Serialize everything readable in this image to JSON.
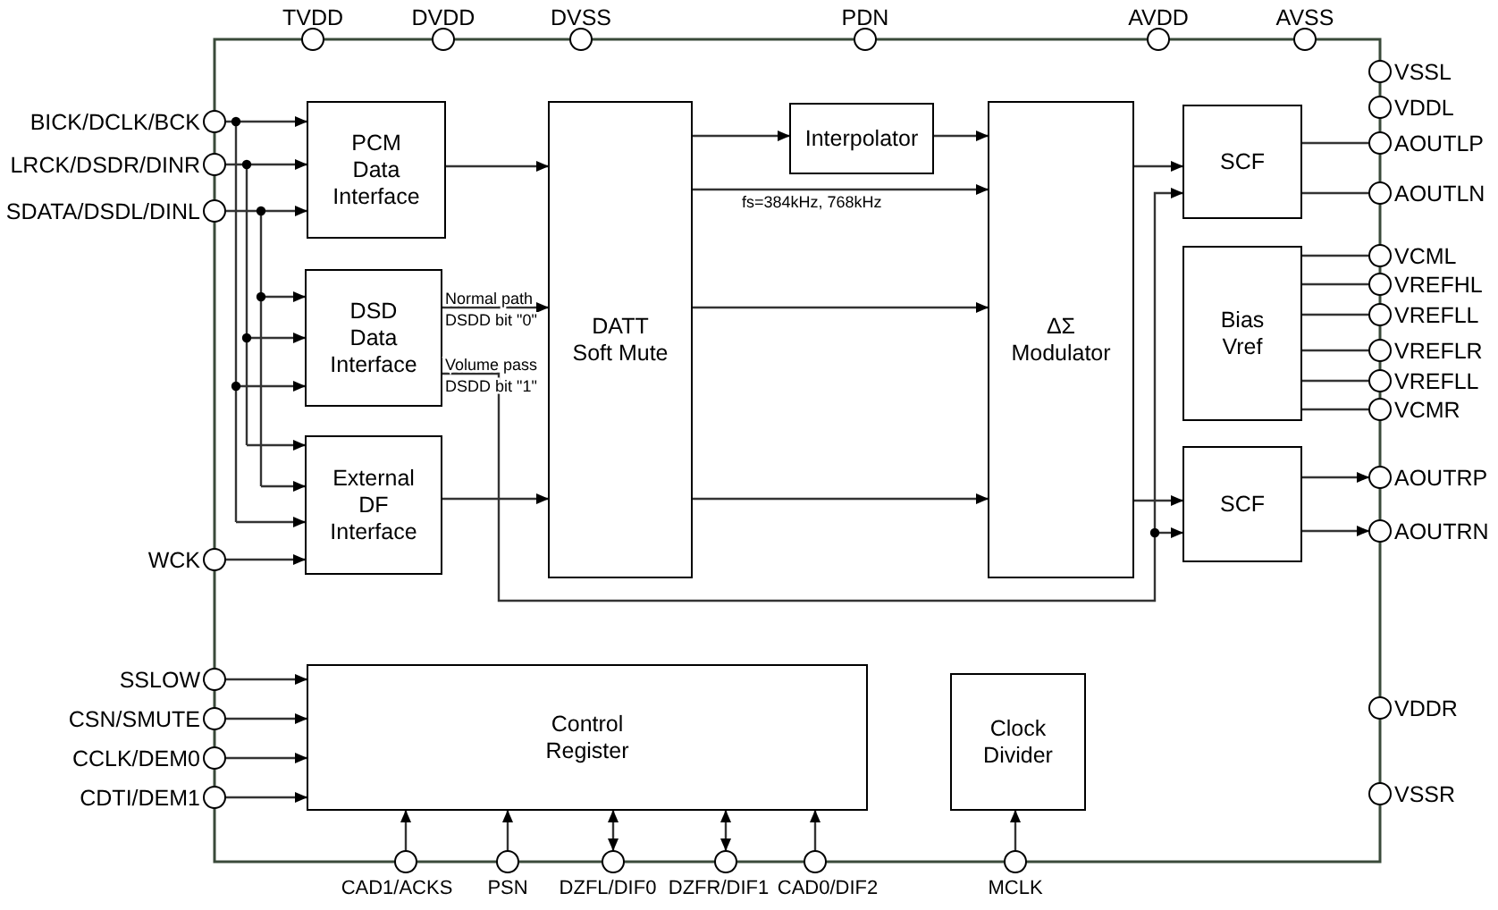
{
  "top_pins": [
    "TVDD",
    "DVDD",
    "DVSS",
    "PDN",
    "AVDD",
    "AVSS"
  ],
  "left_pins": [
    "BICK/DCLK/BCK",
    "LRCK/DSDR/DINR",
    "SDATA/DSDL/DINL",
    "WCK",
    "SSLOW",
    "CSN/SMUTE",
    "CCLK/DEM0",
    "CDTI/DEM1"
  ],
  "right_pins": [
    "VSSL",
    "VDDL",
    "AOUTLP",
    "AOUTLN",
    "VCML",
    "VREFHL",
    "VREFLL",
    "VREFLR",
    "VREFLL",
    "VCMR",
    "AOUTRP",
    "AOUTRN",
    "VDDR",
    "VSSR"
  ],
  "bottom_pins": [
    "CAD1/ACKS",
    "PSN",
    "DZFL/DIF0",
    "DZFR/DIF1",
    "CAD0/DIF2",
    "MCLK"
  ],
  "blocks": [
    {
      "lines": [
        "PCM",
        "Data",
        "Interface"
      ]
    },
    {
      "lines": [
        "DSD",
        "Data",
        "Interface"
      ]
    },
    {
      "lines": [
        "External",
        "DF",
        "Interface"
      ]
    },
    {
      "lines": [
        "DATT",
        "Soft Mute"
      ]
    },
    {
      "lines": [
        "Interpolator"
      ]
    },
    {
      "lines": [
        "ΔΣ",
        "Modulator"
      ]
    },
    {
      "lines": [
        "SCF"
      ]
    },
    {
      "lines": [
        "Bias",
        "Vref"
      ]
    },
    {
      "lines": [
        "SCF"
      ]
    },
    {
      "lines": [
        "Control",
        "Register"
      ]
    },
    {
      "lines": [
        "Clock",
        "Divider"
      ]
    }
  ],
  "path_notes": [
    "Normal path",
    "DSDD bit \"0\"",
    "Volume pass",
    "DSDD bit \"1\""
  ],
  "rate_note": "fs=384kHz, 768kHz"
}
